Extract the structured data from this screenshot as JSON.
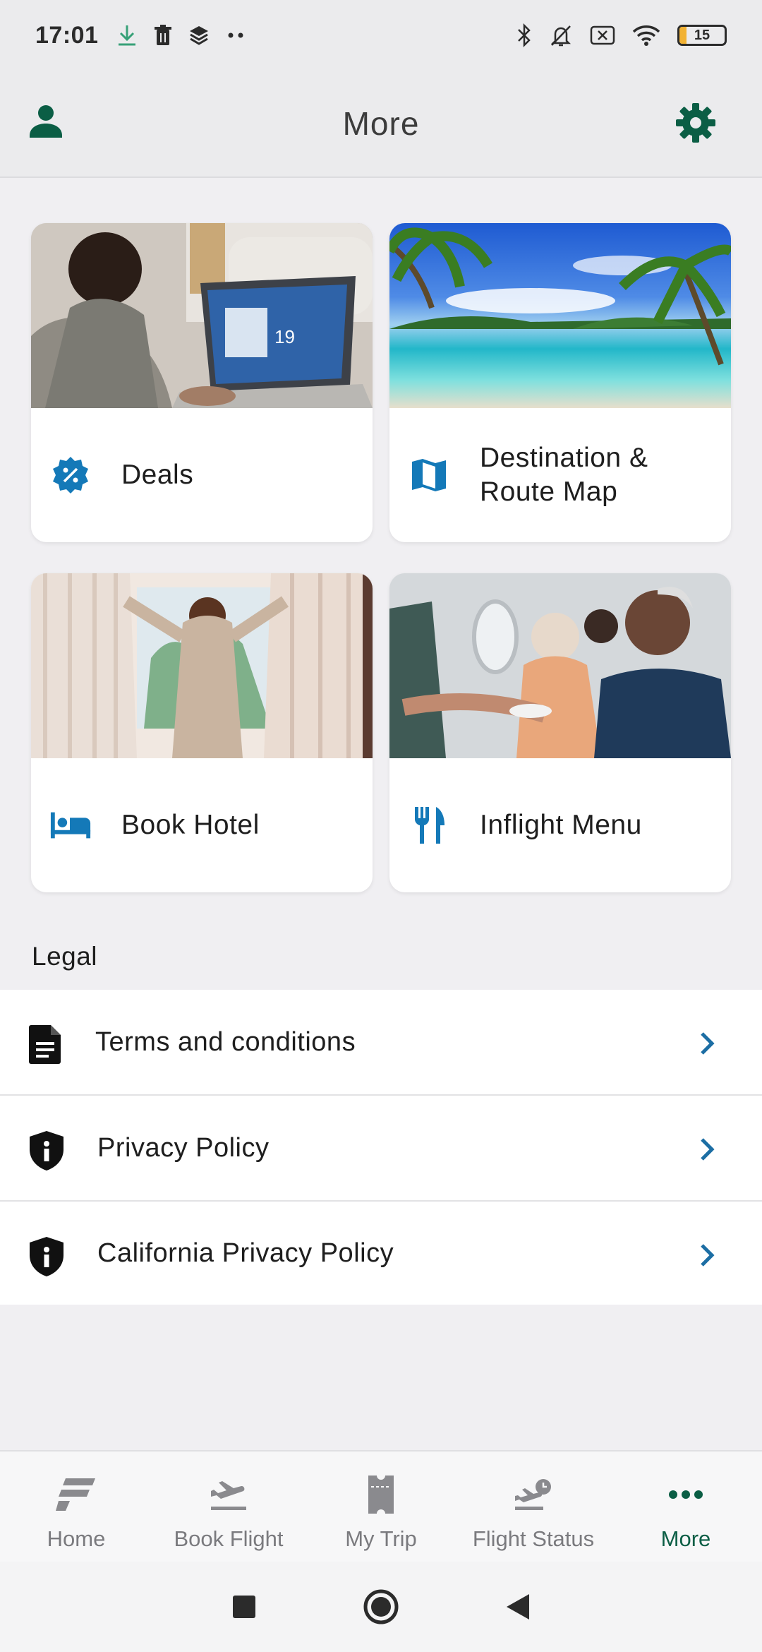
{
  "status_bar": {
    "time": "17:01",
    "battery_level": "15",
    "battery_fraction": 0.15
  },
  "app_bar": {
    "title": "More",
    "profile_icon": "person-icon",
    "settings_icon": "gear-icon"
  },
  "cards": [
    {
      "label": "Deals",
      "icon": "deals-badge-icon"
    },
    {
      "label": "Destination & Route Map",
      "icon": "map-icon"
    },
    {
      "label": "Book Hotel",
      "icon": "bed-icon"
    },
    {
      "label": "Inflight Menu",
      "icon": "fork-knife-icon"
    }
  ],
  "legal": {
    "heading": "Legal",
    "items": [
      {
        "label": "Terms and conditions",
        "icon": "document-icon"
      },
      {
        "label": "Privacy Policy",
        "icon": "shield-info-icon"
      },
      {
        "label": "California Privacy Policy",
        "icon": "shield-info-icon"
      }
    ]
  },
  "bottom_nav": {
    "items": [
      {
        "label": "Home",
        "icon": "home-logo-icon"
      },
      {
        "label": "Book Flight",
        "icon": "plane-departure-icon"
      },
      {
        "label": "My Trip",
        "icon": "ticket-icon"
      },
      {
        "label": "Flight Status",
        "icon": "plane-clock-icon"
      },
      {
        "label": "More",
        "icon": "more-dots-icon",
        "active": true
      }
    ]
  },
  "colors": {
    "brand_green": "#0b5e45",
    "accent_blue": "#1479b8",
    "chevron_blue": "#1c6ea4",
    "background": "#f0eff2"
  }
}
